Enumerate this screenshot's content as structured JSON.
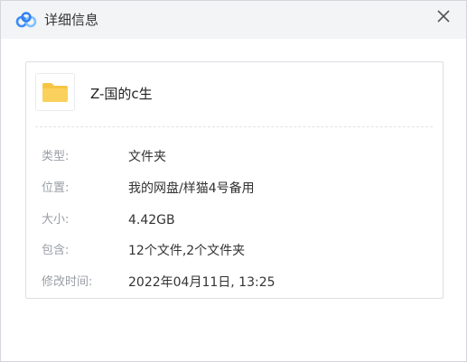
{
  "window": {
    "title": "详细信息",
    "close_glyph": "×"
  },
  "file": {
    "name": "Z-国的c生",
    "icon": "folder-icon"
  },
  "details": [
    {
      "label": "类型:",
      "value": "文件夹"
    },
    {
      "label": "位置:",
      "value": "我的网盘/样猫4号备用"
    },
    {
      "label": "大小:",
      "value": "4.42GB"
    },
    {
      "label": "包含:",
      "value": "12个文件,2个文件夹"
    },
    {
      "label": "修改时间:",
      "value": "2022年04月11日, 13:25"
    }
  ],
  "colors": {
    "brand_blue": "#3b8cf5",
    "brand_light": "#7fc0ff",
    "folder_yellow": "#f7c544"
  }
}
